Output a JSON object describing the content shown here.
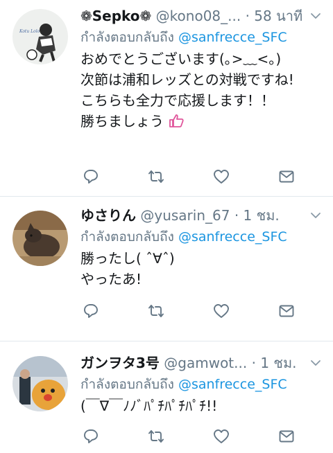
{
  "tweets": [
    {
      "name": "❁Sepko❁",
      "handle": "@kono08_...",
      "dot": "·",
      "time": "58 นาที",
      "reply_prefix": "กำลังตอบกลับถึง",
      "reply_mention": "@sanfrecce_SFC",
      "body": [
        "おめでとうございます(｡>﹏<｡)",
        "次節は浦和レッズとの対戦ですね!",
        "こちらも全力で応援します！！",
        "勝ちましょう"
      ],
      "avatar_text": "Kotu Lolo"
    },
    {
      "name": "ゆさりん",
      "handle": "@yusarin_67",
      "dot": "·",
      "time": "1 ชม.",
      "reply_prefix": "กำลังตอบกลับถึง",
      "reply_mention": "@sanfrecce_SFC",
      "body": [
        "勝ったし( ˆ∀ˆ)",
        "やったあ!"
      ]
    },
    {
      "name": "ガンヲタ3号",
      "handle": "@gamwot...",
      "dot": "·",
      "time": "1 ชม.",
      "reply_prefix": "กำลังตอบกลับถึง",
      "reply_mention": "@sanfrecce_SFC",
      "body": [
        "(￣∇￣ﾉﾉﾞﾊﾟﾁﾊﾟﾁﾊﾟﾁ!!"
      ]
    }
  ],
  "icons": [
    "reply-icon",
    "retweet-icon",
    "like-icon",
    "dm-icon",
    "chevron-down-icon",
    "thumbs-up-emoji"
  ],
  "colors": {
    "link": "#1b95e0",
    "muted": "#657786",
    "divider": "#e1e8ed",
    "emoji": "#e0559b"
  }
}
